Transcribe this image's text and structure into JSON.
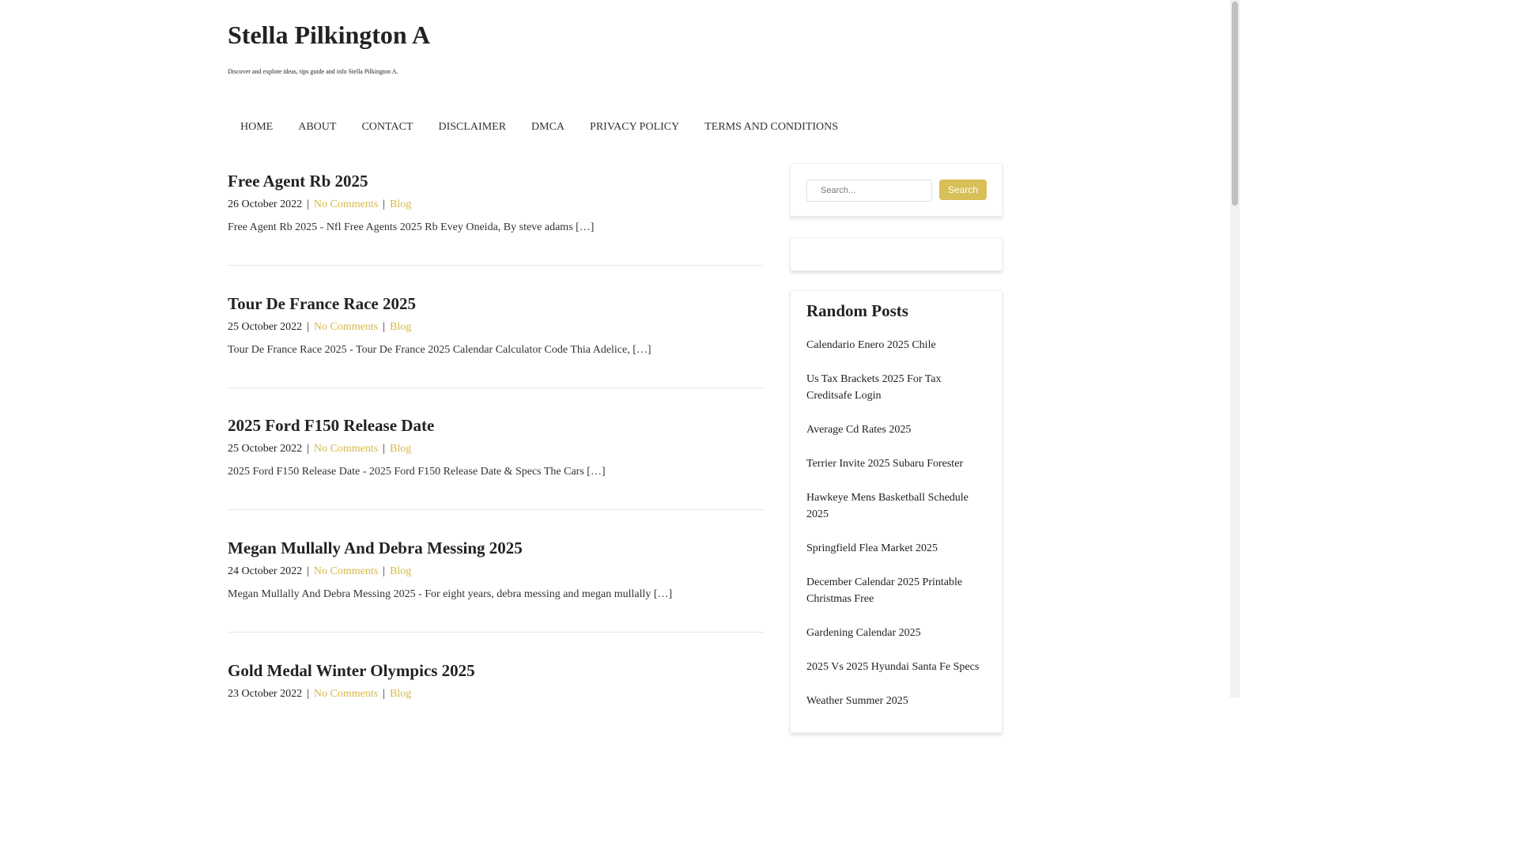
{
  "site": {
    "title": "Stella Pilkington A",
    "description": "Discover and explore ideas, tips guide and info Stella Pilkington A."
  },
  "nav": {
    "items": [
      "HOME",
      "ABOUT",
      "CONTACT",
      "DISCLAIMER",
      "DMCA",
      "PRIVACY POLICY",
      "TERMS AND CONDITIONS"
    ]
  },
  "posts": [
    {
      "title": "Free Agent Rb 2025",
      "date": "26 October 2022",
      "comments": "No Comments",
      "category": "Blog",
      "excerpt": "Free Agent Rb 2025 - Nfl Free Agents 2025 Rb Evey Oneida, By steve adams […]"
    },
    {
      "title": "Tour De France Race 2025",
      "date": "25 October 2022",
      "comments": "No Comments",
      "category": "Blog",
      "excerpt": "Tour De France Race 2025 - Tour De France 2025 Calendar Calculator Code Thia Adelice, […]"
    },
    {
      "title": "2025 Ford F150 Release Date",
      "date": "25 October 2022",
      "comments": "No Comments",
      "category": "Blog",
      "excerpt": "2025 Ford F150 Release Date - 2025 Ford F150 Release Date & Specs The Cars […]"
    },
    {
      "title": "Megan Mullally And Debra Messing 2025",
      "date": "24 October 2022",
      "comments": "No Comments",
      "category": "Blog",
      "excerpt": "Megan Mullally And Debra Messing 2025 - For eight years, debra messing and megan mullally […]"
    },
    {
      "title": "Gold Medal Winter Olympics 2025",
      "date": "23 October 2022",
      "comments": "No Comments",
      "category": "Blog",
      "excerpt": ""
    }
  ],
  "search": {
    "placeholder": "Search...",
    "button_label": "Search"
  },
  "random_posts": {
    "title": "Random Posts",
    "items": [
      "Calendario Enero 2025 Chile",
      "Us Tax Brackets 2025 For Tax Creditsafe Login",
      "Average Cd Rates 2025",
      "Terrier Invite 2025 Subaru Forester",
      "Hawkeye Mens Basketball Schedule 2025",
      "Springfield Flea Market 2025",
      "December Calendar 2025 Printable Christmas Free",
      "Gardening Calendar 2025",
      "2025 Vs 2025 Hyundai Santa Fe Specs",
      "Weather Summer 2025"
    ]
  },
  "colors": {
    "accent": "#d8bf57",
    "link": "#d4b94a"
  }
}
